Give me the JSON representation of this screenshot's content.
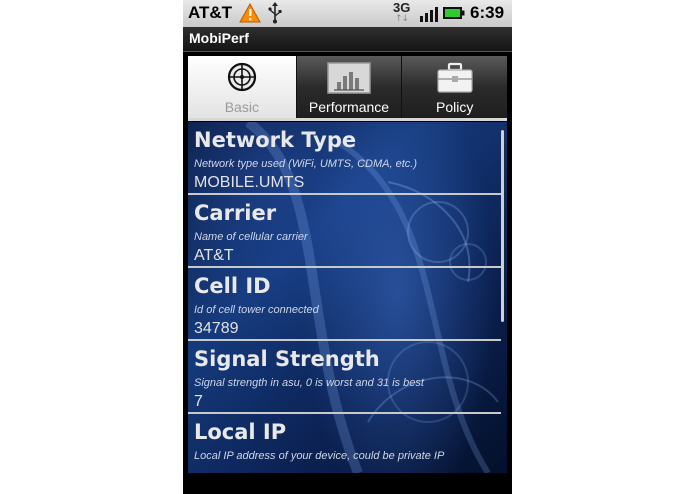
{
  "statusbar": {
    "carrier": "AT&T",
    "network_type": "3G",
    "time": "6:39",
    "icons": [
      "warning-icon",
      "usb-icon",
      "signal-icon",
      "battery-icon"
    ],
    "colors": {
      "warning": "#ff8a00",
      "battery": "#2ecc2e"
    }
  },
  "app": {
    "title": "MobiPerf"
  },
  "tabs": [
    {
      "label": "Basic",
      "icon": "crosshair-icon",
      "selected": true
    },
    {
      "label": "Performance",
      "icon": "bar-chart-icon",
      "selected": false
    },
    {
      "label": "Policy",
      "icon": "briefcase-icon",
      "selected": false
    }
  ],
  "items": [
    {
      "title": "Network Type",
      "description": "Network type used (WiFi, UMTS, CDMA, etc.)",
      "value": "MOBILE.UMTS"
    },
    {
      "title": "Carrier",
      "description": "Name of cellular carrier",
      "value": "AT&T"
    },
    {
      "title": "Cell ID",
      "description": "Id of cell tower connected",
      "value": "34789"
    },
    {
      "title": "Signal Strength",
      "description": "Signal strength in asu, 0 is worst and 31 is best",
      "value": "7"
    },
    {
      "title": "Local IP",
      "description": "Local IP address of your device, could be private IP",
      "value": ""
    }
  ]
}
